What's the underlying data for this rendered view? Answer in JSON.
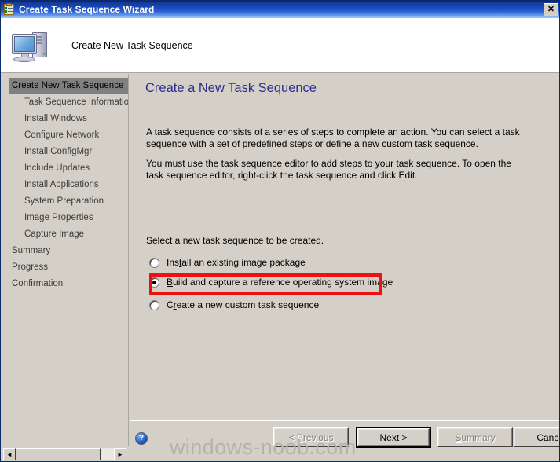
{
  "window": {
    "title": "Create Task Sequence Wizard",
    "titlebar_icon": "task-clipboard-icon",
    "close_label": "✕"
  },
  "header": {
    "title": "Create New Task Sequence",
    "icon": "computer-icon"
  },
  "sidebar": {
    "items": [
      {
        "label": "Create New Task Sequence",
        "selected": true,
        "indent": false
      },
      {
        "label": "Task Sequence Information",
        "selected": false,
        "indent": true
      },
      {
        "label": "Install Windows",
        "selected": false,
        "indent": true
      },
      {
        "label": "Configure Network",
        "selected": false,
        "indent": true
      },
      {
        "label": "Install ConfigMgr",
        "selected": false,
        "indent": true
      },
      {
        "label": "Include Updates",
        "selected": false,
        "indent": true
      },
      {
        "label": "Install Applications",
        "selected": false,
        "indent": true
      },
      {
        "label": "System Preparation",
        "selected": false,
        "indent": true
      },
      {
        "label": "Image Properties",
        "selected": false,
        "indent": true
      },
      {
        "label": "Capture Image",
        "selected": false,
        "indent": true
      },
      {
        "label": "Summary",
        "selected": false,
        "indent": false
      },
      {
        "label": "Progress",
        "selected": false,
        "indent": false
      },
      {
        "label": "Confirmation",
        "selected": false,
        "indent": false
      }
    ],
    "scrollbar": {
      "left_arrow": "◄",
      "right_arrow": "►"
    }
  },
  "main": {
    "page_title": "Create a New Task Sequence",
    "paragraph1": "A task sequence consists of a series of steps to complete an action. You can select a task sequence with a set of predefined steps or define a new custom task sequence.",
    "paragraph2": "You must use the task sequence editor to add steps to your task sequence. To open the task sequence editor, right-click the task sequence and click Edit.",
    "select_label": "Select a new task sequence to be created.",
    "options": [
      {
        "prefix": "Ins",
        "accel": "t",
        "suffix": "all an existing image package",
        "checked": false
      },
      {
        "prefix": "",
        "accel": "B",
        "suffix": "uild and capture a reference operating system image",
        "checked": true
      },
      {
        "prefix": "C",
        "accel": "r",
        "suffix": "eate a new custom task sequence",
        "checked": false
      }
    ],
    "highlight_color": "#ee1111"
  },
  "footer": {
    "help_icon": "help-question-icon",
    "help_glyph": "?",
    "buttons": [
      {
        "prefix": "< ",
        "accel": "P",
        "suffix": "revious",
        "disabled": true,
        "default": false
      },
      {
        "prefix": "",
        "accel": "N",
        "suffix": "ext >",
        "disabled": false,
        "default": true
      },
      {
        "prefix": "",
        "accel": "S",
        "suffix": "ummary",
        "disabled": true,
        "default": false
      },
      {
        "prefix": "Cancel",
        "accel": "",
        "suffix": "",
        "disabled": false,
        "default": false
      }
    ]
  },
  "watermark": "windows-noob.com"
}
